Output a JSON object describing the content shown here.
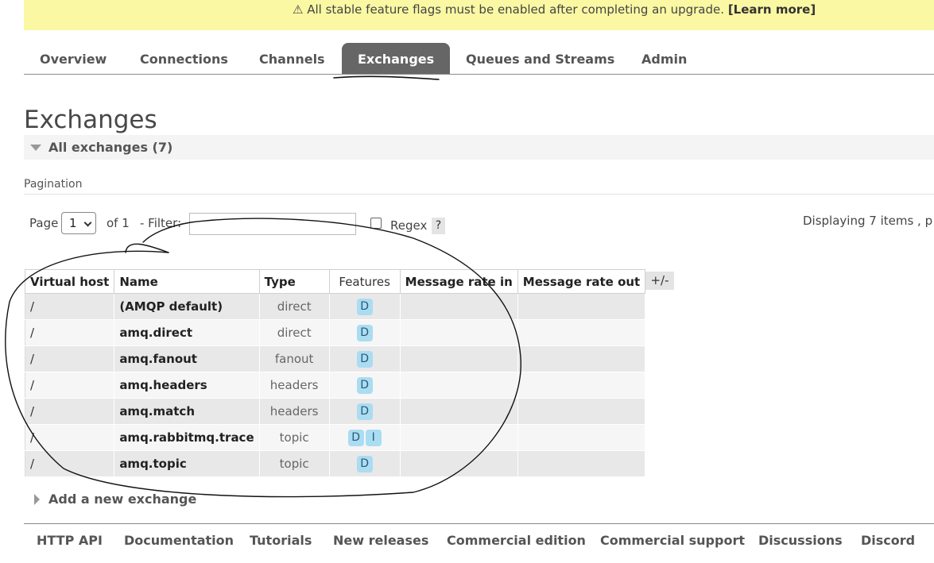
{
  "banner": {
    "icon": "warning-icon",
    "glyph": "⚠",
    "message": "All stable feature flags must be enabled after completing an upgrade.",
    "link": "[Learn more]"
  },
  "nav": {
    "tabs": [
      "Overview",
      "Connections",
      "Channels",
      "Exchanges",
      "Queues and Streams",
      "Admin"
    ],
    "active": "Exchanges"
  },
  "page": {
    "title": "Exchanges",
    "section_label": "All exchanges (7)",
    "pagination_label": "Pagination"
  },
  "filter": {
    "page_label": "Page",
    "page_value": "1",
    "of_label": "of 1",
    "filter_label": "- Filter:",
    "filter_value": "",
    "regex_label": "Regex",
    "regex_checked": false,
    "help_label": "?",
    "displaying": "Displaying 7 items , p"
  },
  "table": {
    "headers": [
      "Virtual host",
      "Name",
      "Type",
      "Features",
      "Message rate in",
      "Message rate out"
    ],
    "toggle_columns": "+/-",
    "rows": [
      {
        "vhost": "/",
        "name": "(AMQP default)",
        "type": "direct",
        "features": [
          "D"
        ],
        "rate_in": "",
        "rate_out": ""
      },
      {
        "vhost": "/",
        "name": "amq.direct",
        "type": "direct",
        "features": [
          "D"
        ],
        "rate_in": "",
        "rate_out": ""
      },
      {
        "vhost": "/",
        "name": "amq.fanout",
        "type": "fanout",
        "features": [
          "D"
        ],
        "rate_in": "",
        "rate_out": ""
      },
      {
        "vhost": "/",
        "name": "amq.headers",
        "type": "headers",
        "features": [
          "D"
        ],
        "rate_in": "",
        "rate_out": ""
      },
      {
        "vhost": "/",
        "name": "amq.match",
        "type": "headers",
        "features": [
          "D"
        ],
        "rate_in": "",
        "rate_out": ""
      },
      {
        "vhost": "/",
        "name": "amq.rabbitmq.trace",
        "type": "topic",
        "features": [
          "D",
          "I"
        ],
        "rate_in": "",
        "rate_out": ""
      },
      {
        "vhost": "/",
        "name": "amq.topic",
        "type": "topic",
        "features": [
          "D"
        ],
        "rate_in": "",
        "rate_out": ""
      }
    ]
  },
  "add_exchange": {
    "label": "Add a new exchange"
  },
  "footer": {
    "links": [
      "HTTP API",
      "Documentation",
      "Tutorials",
      "New releases",
      "Commercial edition",
      "Commercial support",
      "Discussions",
      "Discord"
    ]
  },
  "colors": {
    "banner_bg": "#fbf8a3",
    "tab_active_bg": "#666666",
    "badge_bg": "#aadcf2",
    "row_odd": "#e8e8e8",
    "row_even": "#f6f6f6"
  }
}
